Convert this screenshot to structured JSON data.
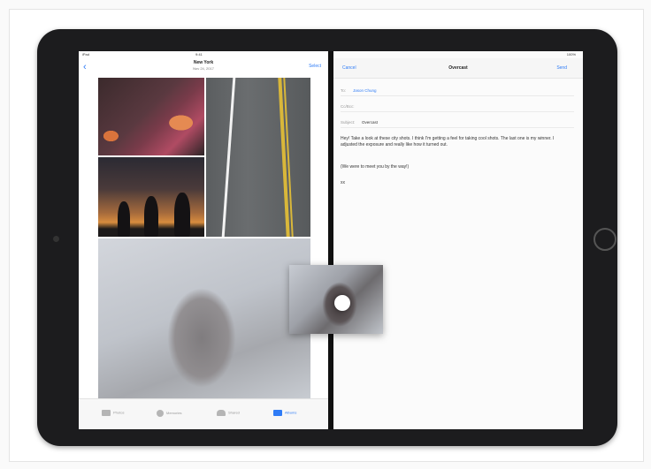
{
  "left_pane": {
    "status_left": "iPad",
    "status_time": "9:41",
    "status_right": "100%",
    "nav_title": "New York",
    "nav_subtitle": "Nov 24, 2017",
    "select_label": "Select",
    "back_icon": "chevron-left-icon",
    "tabs": [
      {
        "label": "Photos",
        "icon": "photos-icon",
        "active": false
      },
      {
        "label": "Memories",
        "icon": "memories-icon",
        "active": false
      },
      {
        "label": "Shared",
        "icon": "cloud-icon",
        "active": false
      },
      {
        "label": "Albums",
        "icon": "albums-icon",
        "active": true
      }
    ]
  },
  "compose": {
    "cancel_label": "Cancel",
    "title": "Overcast",
    "send_label": "Send",
    "to_label": "To:",
    "to_value": "Jason Chung",
    "cc_label": "Cc/Bcc:",
    "subject_label": "Subject:",
    "subject_value": "Overcast",
    "body_paragraph_1": "Hey! Take a look at these city shots. I think I'm getting a feel for taking cool shots. The last one is my winner. I adjusted the exposure and really like how it turned out.",
    "body_paragraph_2": "(We were to meet you by the way!)",
    "signature": "xx"
  },
  "colors": {
    "accent": "#2f7cf6",
    "device_bezel": "#1c1c1e"
  }
}
